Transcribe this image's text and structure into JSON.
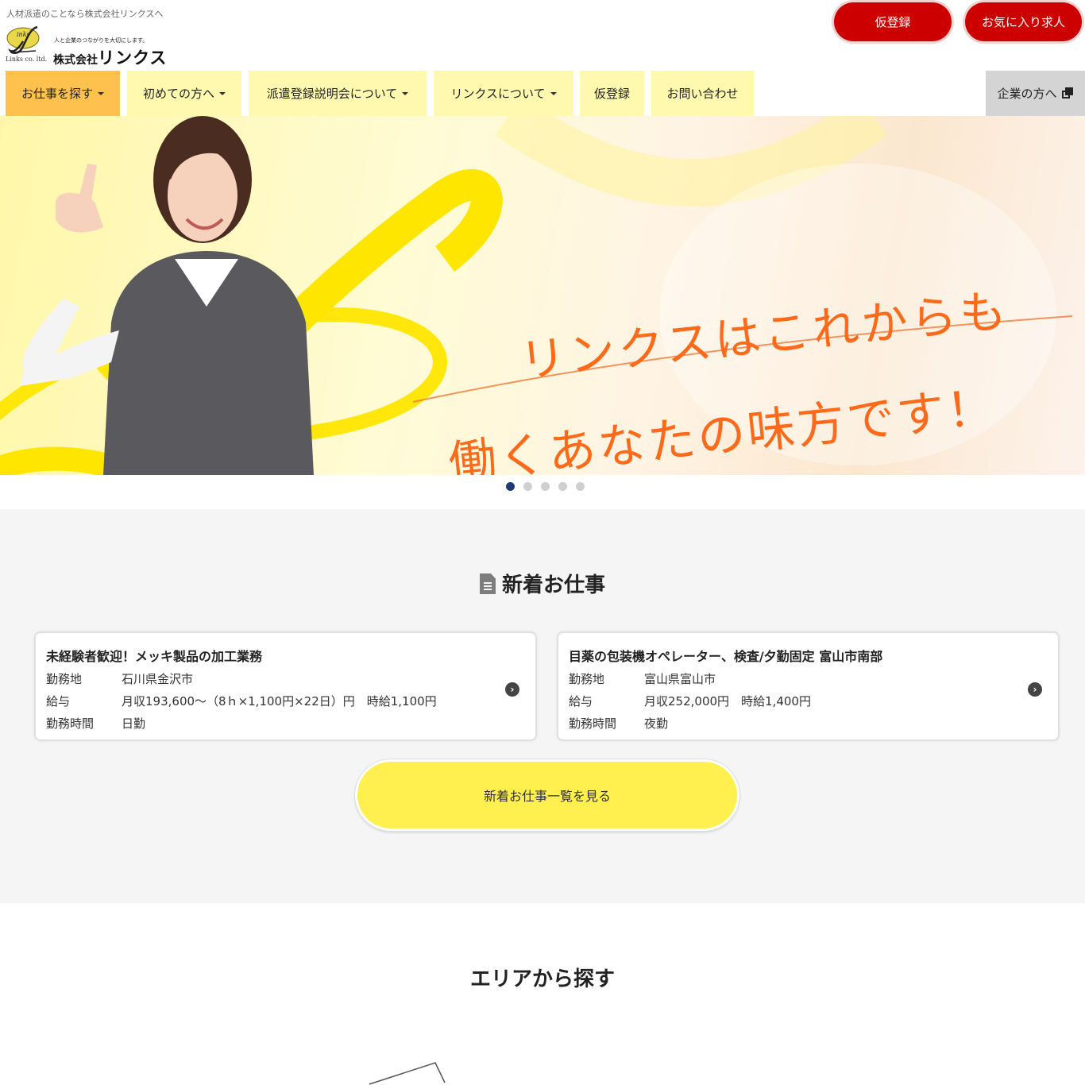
{
  "header": {
    "topline": "人材派遣のことなら株式会社リンクスへ",
    "logo": {
      "mark_text": "inks",
      "sub": "Links co. ltd.",
      "tagline": "人と企業のつながりを大切にします。",
      "company_prefix": "株式会社",
      "company_name": "リンクス"
    },
    "buttons": {
      "register": "仮登録",
      "favorites": "お気に入り求人"
    }
  },
  "nav": {
    "items": [
      {
        "label": "お仕事を探す",
        "dropdown": true
      },
      {
        "label": "初めての方へ",
        "dropdown": true
      },
      {
        "label": "派遣登録説明会について",
        "dropdown": true
      },
      {
        "label": "リンクスについて",
        "dropdown": true
      },
      {
        "label": "仮登録",
        "dropdown": false
      },
      {
        "label": "お問い合わせ",
        "dropdown": false
      }
    ],
    "corporate": "企業の方へ"
  },
  "hero": {
    "line1": "リンクスはこれからも",
    "line2": "働くあなたの味方です！",
    "slide_count": 5,
    "active_slide": 1
  },
  "new_jobs": {
    "title": "新着お仕事",
    "jobs": [
      {
        "title": "未経験者歓迎！メッキ製品の加工業務",
        "location_label": "勤務地",
        "location": "石川県金沢市",
        "salary_label": "給与",
        "salary": "月収193,600～（8ｈ×1,100円×22日）円　時給1,100円",
        "hours_label": "勤務時間",
        "hours": "日勤"
      },
      {
        "title": "目薬の包装機オペレーター、検査/夕勤固定 富山市南部",
        "location_label": "勤務地",
        "location": "富山県富山市",
        "salary_label": "給与",
        "salary": "月収252,000円　時給1,400円",
        "hours_label": "勤務時間",
        "hours": "夜勤"
      }
    ],
    "more_button": "新着お仕事一覧を見る"
  },
  "area": {
    "title": "エリアから探す"
  },
  "colors": {
    "brand_red": "#cc0000",
    "nav_yellow": "#fff9b0",
    "nav_active": "#ffc14d",
    "button_yellow": "#fff050",
    "hero_orange": "#ff6a1a"
  }
}
